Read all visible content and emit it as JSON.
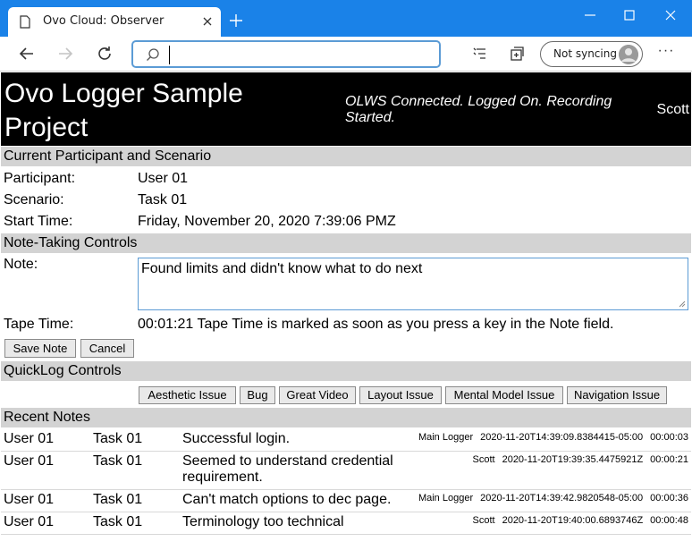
{
  "browser": {
    "tab_title": "Ovo Cloud: Observer",
    "address_value": "",
    "sync_label": "Not syncing"
  },
  "header": {
    "title": "Ovo Logger Sample Project",
    "status": "OLWS Connected. Logged On. Recording Started.",
    "user": "Scott"
  },
  "current": {
    "section_title": "Current Participant and Scenario",
    "participant_label": "Participant:",
    "participant_value": "User 01",
    "scenario_label": "Scenario:",
    "scenario_value": "Task 01",
    "start_label": "Start Time:",
    "start_value": "Friday, November 20, 2020 7:39:06 PMZ"
  },
  "note_controls": {
    "section_title": "Note-Taking Controls",
    "note_label": "Note:",
    "note_value": "Found limits and didn't know what to do next",
    "tape_label": "Tape Time:",
    "tape_value": "00:01:21 Tape Time is marked as soon as you press a key in the Note field.",
    "save_label": "Save Note",
    "cancel_label": "Cancel"
  },
  "quicklog": {
    "section_title": "QuickLog Controls",
    "buttons": [
      "Aesthetic Issue",
      "Bug",
      "Great Video",
      "Layout Issue",
      "Mental Model Issue",
      "Navigation Issue"
    ]
  },
  "recent": {
    "section_title": "Recent Notes",
    "rows": [
      {
        "participant": "User 01",
        "task": "Task 01",
        "note": "Successful login.",
        "logger": "Main Logger",
        "timestamp": "2020-11-20T14:39:09.8384415-05:00",
        "tape": "00:00:03"
      },
      {
        "participant": "User 01",
        "task": "Task 01",
        "note": "Seemed to understand credential requirement.",
        "logger": "Scott",
        "timestamp": "2020-11-20T19:39:35.4475921Z",
        "tape": "00:00:21"
      },
      {
        "participant": "User 01",
        "task": "Task 01",
        "note": "Can't match options to dec page.",
        "logger": "Main Logger",
        "timestamp": "2020-11-20T14:39:42.9820548-05:00",
        "tape": "00:00:36"
      },
      {
        "participant": "User 01",
        "task": "Task 01",
        "note": "Terminology too technical",
        "logger": "Scott",
        "timestamp": "2020-11-20T19:40:00.6893746Z",
        "tape": "00:00:48"
      }
    ]
  },
  "colors": {
    "titlebar": "#1a82e8",
    "header_bg": "#000000",
    "section_bg": "#d3d3d3",
    "focus_border": "#5b9bd5"
  }
}
